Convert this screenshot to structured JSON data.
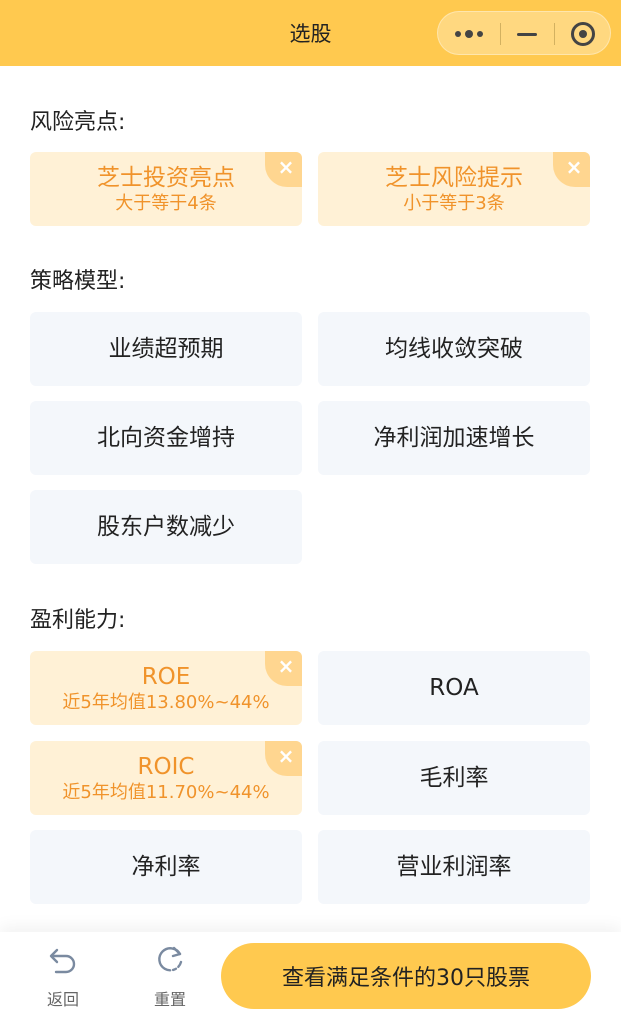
{
  "header": {
    "title": "选股",
    "more_icon": "more-dots-icon",
    "minimize_icon": "minus-icon",
    "close_icon": "target-circle-icon",
    "background_color": "#ffc94f"
  },
  "sections": {
    "risk": {
      "title": "风险亮点:",
      "items": [
        {
          "label": "芝士投资亮点",
          "condition": "大于等于4条",
          "selected": true
        },
        {
          "label": "芝士风险提示",
          "condition": "小于等于3条",
          "selected": true
        }
      ]
    },
    "strategy": {
      "title": "策略模型:",
      "items": [
        {
          "label": "业绩超预期",
          "selected": false
        },
        {
          "label": "均线收敛突破",
          "selected": false
        },
        {
          "label": "北向资金增持",
          "selected": false
        },
        {
          "label": "净利润加速增长",
          "selected": false
        },
        {
          "label": "股东户数减少",
          "selected": false
        }
      ]
    },
    "profit": {
      "title": "盈利能力:",
      "items": [
        {
          "label": "ROE",
          "condition": "近5年均值13.80%~44%",
          "selected": true
        },
        {
          "label": "ROA",
          "selected": false
        },
        {
          "label": "ROIC",
          "condition": "近5年均值11.70%~44%",
          "selected": true
        },
        {
          "label": "毛利率",
          "selected": false
        },
        {
          "label": "净利率",
          "selected": false
        },
        {
          "label": "营业利润率",
          "selected": false
        }
      ]
    }
  },
  "remove_glyph": "×",
  "bottom": {
    "back_label": "返回",
    "reset_label": "重置",
    "cta_label": "查看满足条件的30只股票",
    "back_icon": "undo-arrow-icon",
    "reset_icon": "refresh-icon"
  },
  "colors": {
    "accent": "#ffc94f",
    "selected_text": "#f0932b",
    "selected_bg": "#fff1d6",
    "card_bg": "#f4f7fb"
  }
}
